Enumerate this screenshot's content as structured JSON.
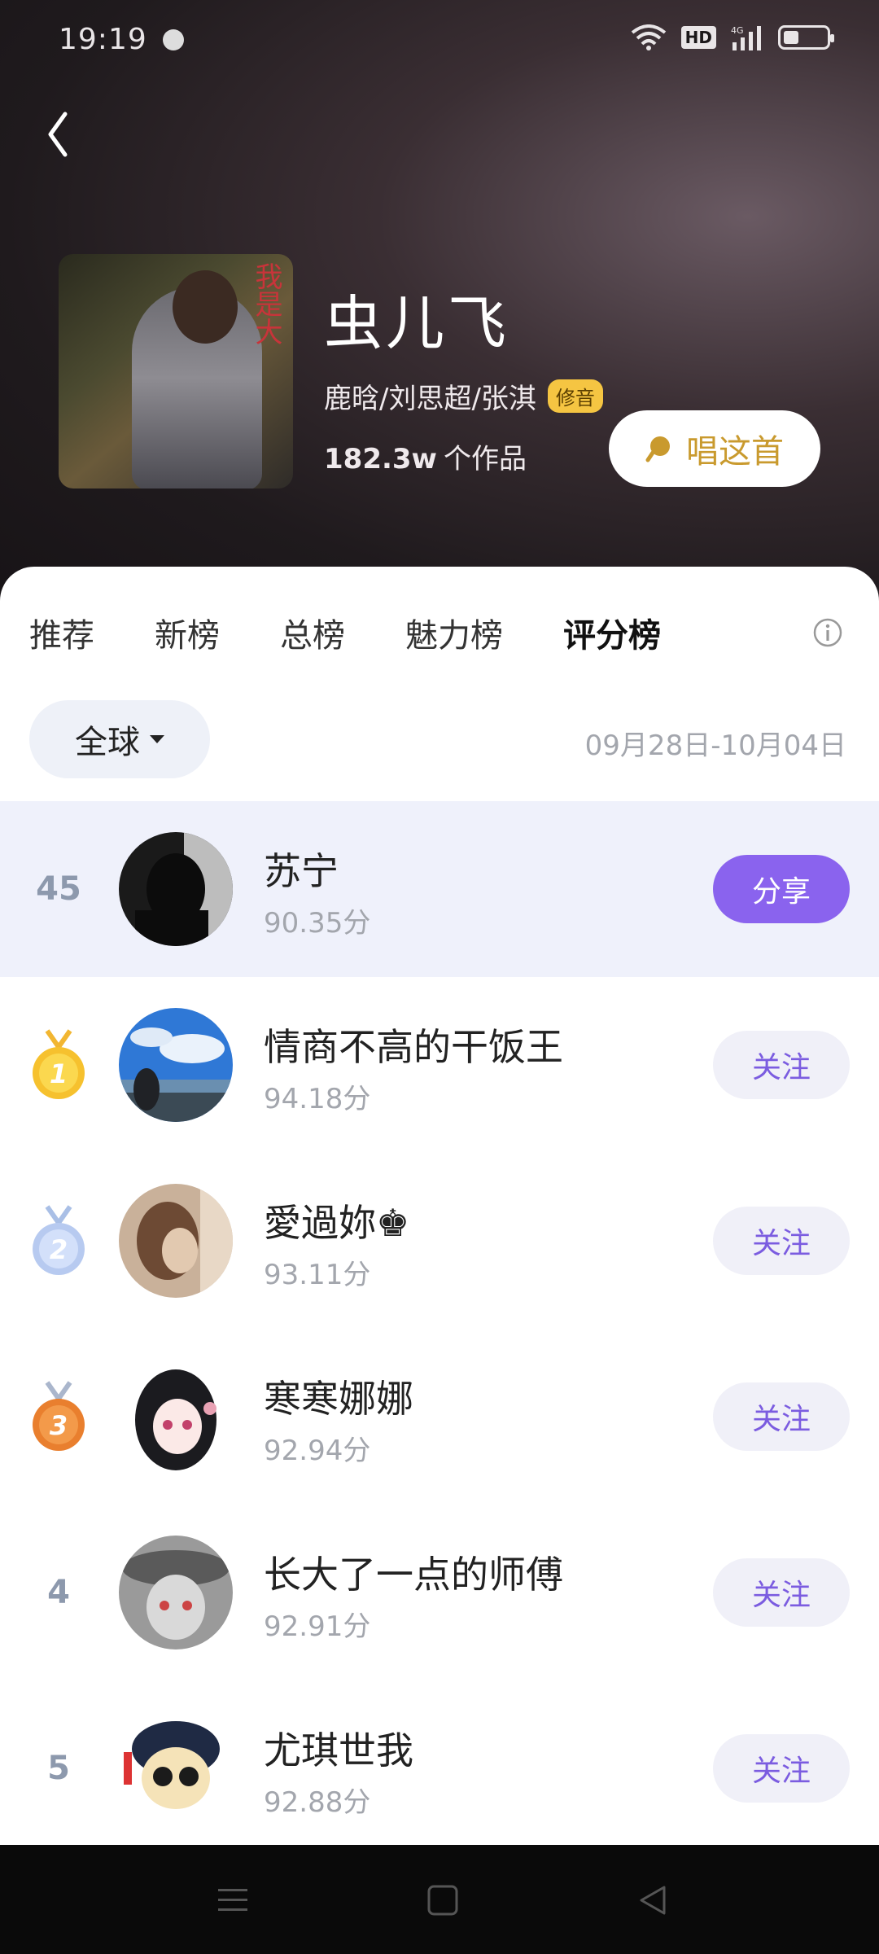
{
  "status": {
    "time": "19:19",
    "hd": "HD",
    "network": "4G",
    "battery_level": 0.35
  },
  "header": {
    "song_title": "虫儿飞",
    "artists": "鹿晗/刘思超/张淇",
    "badge": "修音",
    "works_count": "182.3w",
    "works_suffix": "个作品",
    "sing_button": "唱这首",
    "cover_text": "我是大"
  },
  "tabs": [
    {
      "label": "推荐",
      "active": false
    },
    {
      "label": "新榜",
      "active": false
    },
    {
      "label": "总榜",
      "active": false
    },
    {
      "label": "魅力榜",
      "active": false
    },
    {
      "label": "评分榜",
      "active": true
    }
  ],
  "filter": {
    "region": "全球",
    "date_range": "09月28日-10月04日"
  },
  "my_row": {
    "rank": "45",
    "name": "苏宁",
    "score": "90.35分",
    "button": "分享"
  },
  "rows": [
    {
      "rank": "1",
      "medal": "gold",
      "name": "情商不高的干饭王",
      "score": "94.18分",
      "button": "关注"
    },
    {
      "rank": "2",
      "medal": "silver",
      "name": "愛過妳♚",
      "score": "93.11分",
      "button": "关注"
    },
    {
      "rank": "3",
      "medal": "bronze",
      "name": "寒寒娜娜",
      "score": "92.94分",
      "button": "关注"
    },
    {
      "rank": "4",
      "medal": "",
      "name": "长大了一点的师傅",
      "score": "92.91分",
      "button": "关注"
    },
    {
      "rank": "5",
      "medal": "",
      "name": "尤琪世我",
      "score": "92.88分",
      "button": "关注"
    }
  ],
  "colors": {
    "accent": "#8a63ee",
    "gold": "#f6d24a",
    "follow_text": "#7b5ce0"
  },
  "icons": [
    "back-arrow-icon",
    "wifi-icon",
    "signal-icon",
    "battery-icon",
    "mic-icon",
    "info-icon",
    "caret-down-icon",
    "medal-icon",
    "menu-icon",
    "home-icon",
    "back-triangle-icon"
  ]
}
